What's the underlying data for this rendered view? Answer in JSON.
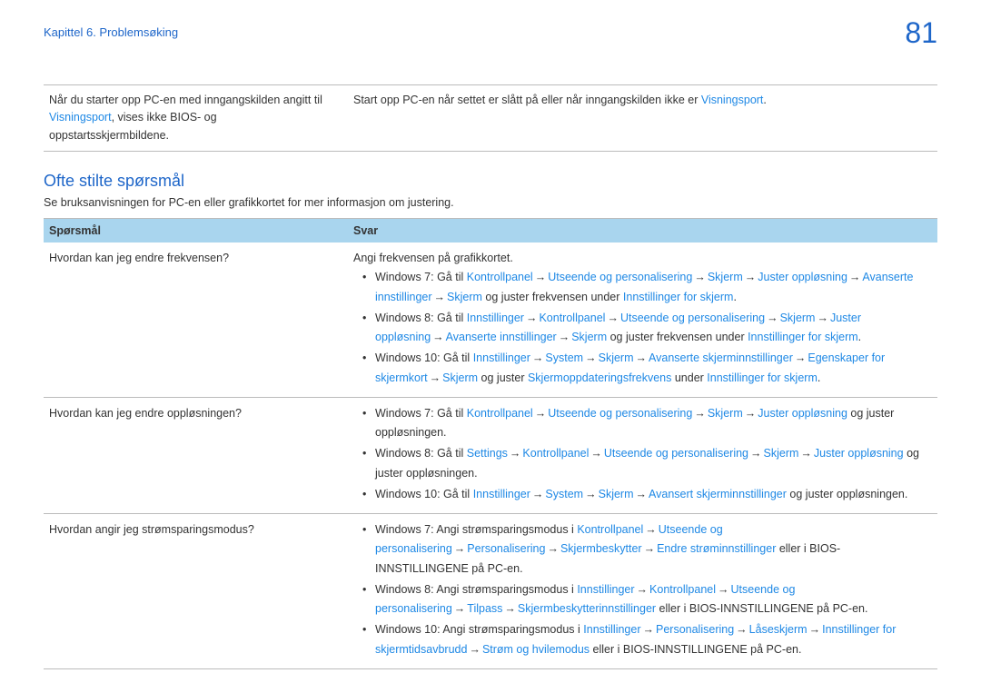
{
  "header": {
    "chapter": "Kapittel 6. Problemsøking",
    "page_number": "81"
  },
  "info_row": {
    "left_pre": "Når du starter opp PC-en med inngangskilden angitt til ",
    "left_hl": "Visningsport",
    "left_post": ", vises ikke BIOS- og oppstartsskjermbildene.",
    "right_pre": "Start opp PC-en når settet er slått på eller når inngangskilden ikke er ",
    "right_hl": "Visningsport",
    "right_post": "."
  },
  "section": {
    "title": "Ofte stilte spørsmål",
    "desc": "Se bruksanvisningen for PC-en eller grafikkortet for mer informasjon om justering."
  },
  "faq_headers": {
    "q": "Spørsmål",
    "a": "Svar"
  },
  "row1": {
    "q": "Hvordan kan jeg endre frekvensen?",
    "intro": "Angi frekvensen på grafikkortet.",
    "b1_pre": "Windows 7: Gå til ",
    "b1_h1": "Kontrollpanel",
    "b1_h2": "Utseende og personalisering",
    "b1_h3": "Skjerm",
    "b1_h4": "Juster oppløsning",
    "b1_h5": "Avanserte innstillinger",
    "b1_h6": "Skjerm",
    "b1_mid": " og juster frekvensen under ",
    "b1_h7": "Innstillinger for skjerm",
    "b2_pre": "Windows 8: Gå til ",
    "b2_h1": "Innstillinger",
    "b2_h2": "Kontrollpanel",
    "b2_h3": "Utseende og personalisering",
    "b2_h4": "Skjerm",
    "b2_h5": "Juster oppløsning",
    "b2_h6": "Avanserte innstillinger",
    "b2_h7": "Skjerm",
    "b2_mid": " og juster frekvensen under ",
    "b2_h8": "Innstillinger for skjerm",
    "b3_pre": "Windows 10: Gå til ",
    "b3_h1": "Innstillinger",
    "b3_h2": "System",
    "b3_h3": "Skjerm",
    "b3_h4": "Avanserte skjerminnstillinger",
    "b3_h5": "Egenskaper for skjermkort",
    "b3_h6": "Skjerm",
    "b3_mid": " og juster ",
    "b3_h7": "Skjermoppdateringsfrekvens",
    "b3_mid2": " under ",
    "b3_h8": "Innstillinger for skjerm",
    "period": "."
  },
  "row2": {
    "q": "Hvordan kan jeg endre oppløsningen?",
    "b1_pre": "Windows 7: Gå til ",
    "b1_h1": "Kontrollpanel",
    "b1_h2": "Utseende og personalisering",
    "b1_h3": "Skjerm",
    "b1_h4": "Juster oppløsning",
    "b1_post": " og juster oppløsningen.",
    "b2_pre": "Windows 8: Gå til ",
    "b2_h1": "Settings",
    "b2_h2": "Kontrollpanel",
    "b2_h3": "Utseende og personalisering",
    "b2_h4": "Skjerm",
    "b2_h5": "Juster oppløsning",
    "b2_post": " og juster oppløsningen.",
    "b3_pre": "Windows 10: Gå til ",
    "b3_h1": "Innstillinger",
    "b3_h2": "System",
    "b3_h3": "Skjerm",
    "b3_h4": "Avansert skjerminnstillinger",
    "b3_post": " og juster oppløsningen."
  },
  "row3": {
    "q": "Hvordan angir jeg strømsparingsmodus?",
    "b1_pre": "Windows 7: Angi strømsparingsmodus i ",
    "b1_h1": "Kontrollpanel",
    "b1_h2": "Utseende og personalisering",
    "b1_h3": "Personalisering",
    "b1_h4": "Skjermbeskytter",
    "b1_h5": "Endre strøminnstillinger",
    "b1_post": " eller i BIOS-INNSTILLINGENE på PC-en.",
    "b2_pre": "Windows 8: Angi strømsparingsmodus i ",
    "b2_h1": "Innstillinger",
    "b2_h2": "Kontrollpanel",
    "b2_h3": "Utseende og personalisering",
    "b2_h4": "Tilpass",
    "b2_h5": "Skjermbeskytterinnstillinger",
    "b2_post": " eller i BIOS-INNSTILLINGENE på PC-en.",
    "b3_pre": "Windows 10: Angi strømsparingsmodus i ",
    "b3_h1": "Innstillinger",
    "b3_h2": "Personalisering",
    "b3_h3": "Låseskjerm",
    "b3_h4": "Innstillinger for skjermtidsavbrudd",
    "b3_h5": "Strøm og hvilemodus",
    "b3_post": " eller i BIOS-INNSTILLINGENE på PC-en."
  },
  "arrow": "→"
}
